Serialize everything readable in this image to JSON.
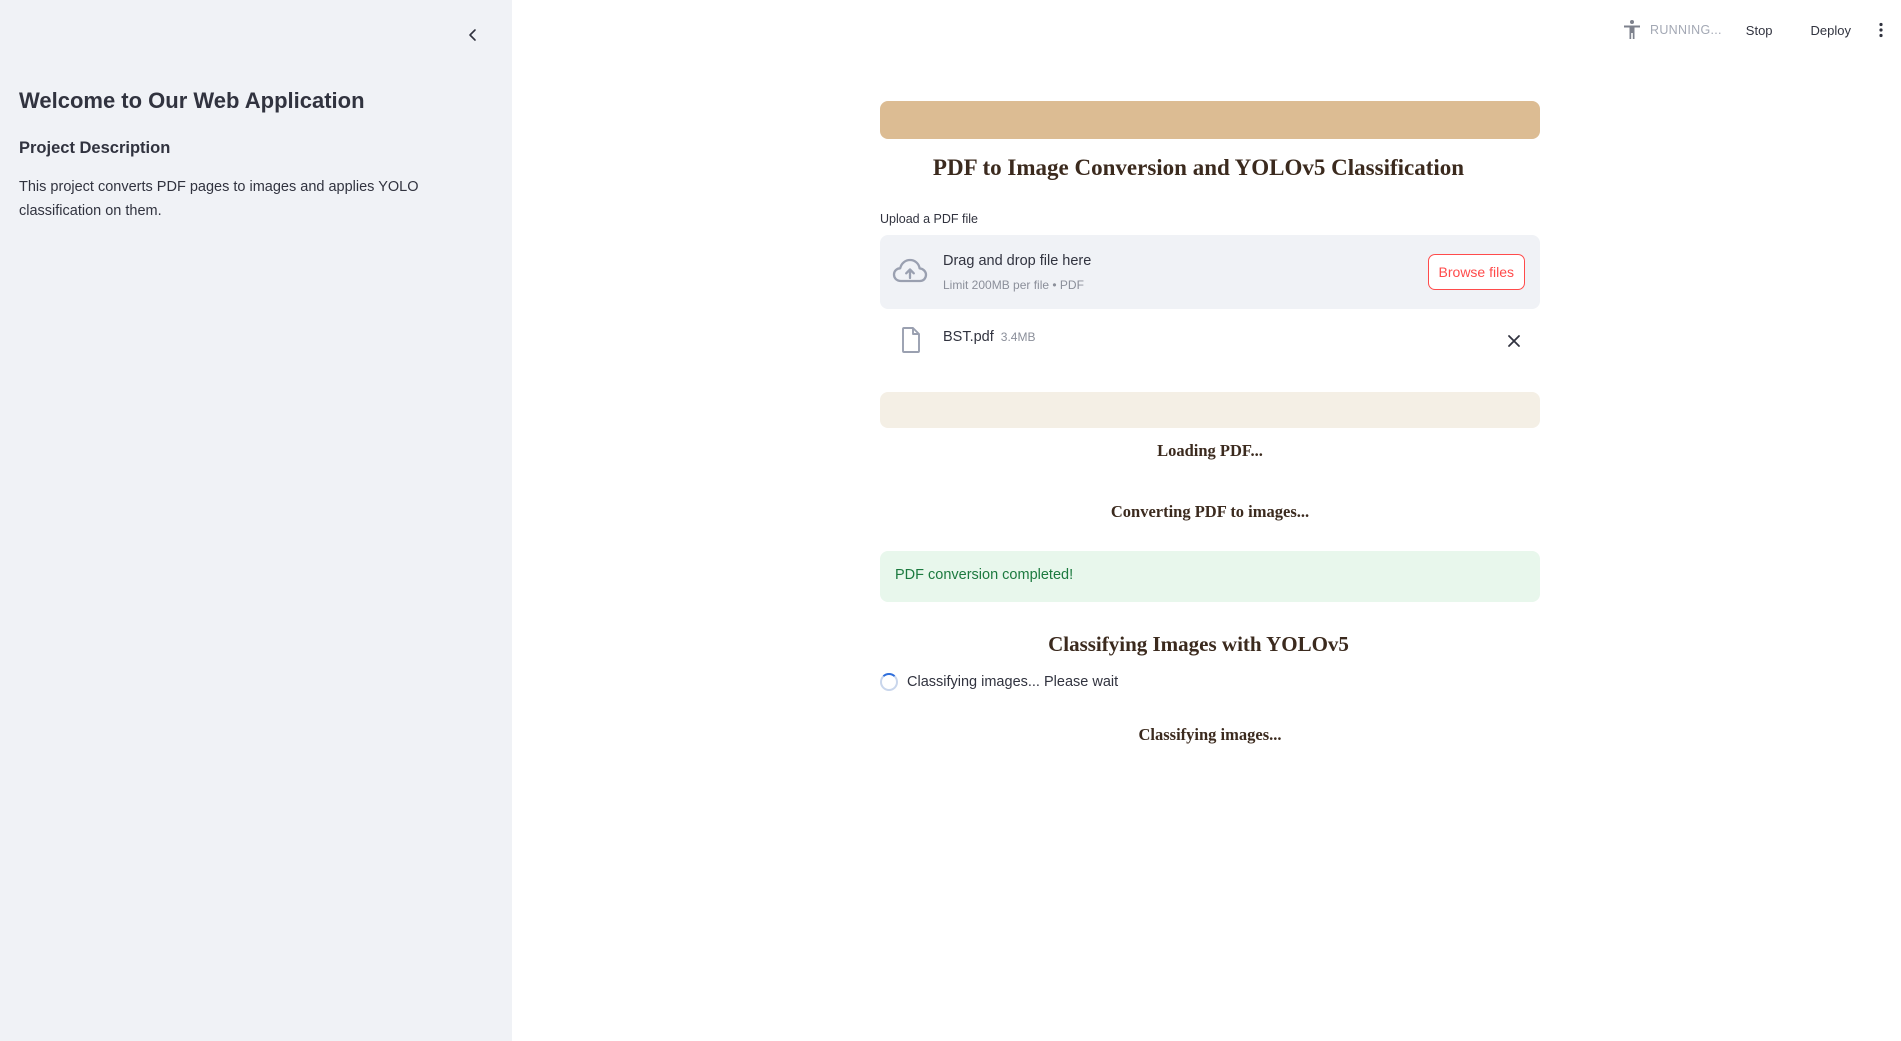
{
  "sidebar": {
    "title": "Welcome to Our Web Application",
    "subtitle": "Project Description",
    "description": "This project converts PDF pages to images and applies YOLO classification on them."
  },
  "header": {
    "status": "RUNNING...",
    "stop_label": "Stop",
    "deploy_label": "Deploy"
  },
  "main": {
    "title": "PDF to Image Conversion and YOLOv5 Classification",
    "upload": {
      "label": "Upload a PDF file",
      "drag_text": "Drag and drop file here",
      "limit_text": "Limit 200MB per file • PDF",
      "browse_label": "Browse files"
    },
    "file": {
      "name": "BST.pdf",
      "size": "3.4MB"
    },
    "status_loading": "Loading PDF...",
    "status_converting": "Converting PDF to images...",
    "success_message": "PDF conversion completed!",
    "section_title": "Classifying Images with YOLOv5",
    "spinner_text": "Classifying images... Please wait",
    "status_classifying": "Classifying images..."
  },
  "colors": {
    "banner_top": "#dcbc93",
    "banner_light": "#f4efe5",
    "accent_red": "#ff4b4b",
    "success_bg": "#e8f7ec",
    "success_text": "#1c7a3f"
  },
  "icons": {
    "collapse": "chevron-left-icon",
    "running": "person-icon",
    "menu": "kebab-menu-icon",
    "upload": "cloud-upload-icon",
    "file": "file-icon",
    "remove": "close-icon"
  }
}
